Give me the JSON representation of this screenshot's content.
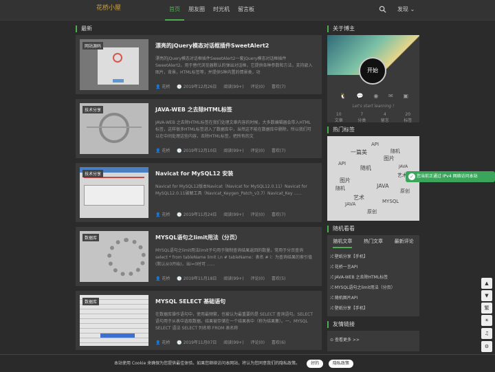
{
  "header": {
    "logo": "花桥小屋",
    "nav": [
      "首页",
      "朋友圈",
      "时光机",
      "留言板"
    ],
    "discover": "发现 ⌄"
  },
  "main": {
    "section_title": "最新",
    "posts": [
      {
        "tag": "网站源码",
        "title": "漂亮的jQuery模态对话框插件SweetAlert2",
        "desc": "漂亮的jQuery模态对话框插件SweetAlert2一套jQuery模态对话框插件SweetAlert2。用于替代浏览器默认的弹出对话框，它提供各种参数和方法，支持嵌入图片，背景，HTML标签等，并提供5种内置的情景类，功",
        "author": "花桥",
        "date": "2019年12月26日",
        "reads": "阅读(99+)",
        "comments": "评论(0)",
        "likes": "喜欢(7)"
      },
      {
        "tag": "技术分享",
        "title": "JAVA-WEB 之去除HTML标签",
        "desc": "JAVA-WEB 之去除HTML标签在我们处理文章内容的时候，大多数编辑器会带入HTML标签，这样很多HTML标签进入了数据库中，当然这不能在数据库中删除，所以我们可以在中间处理这些内容，去除HTML标签，把所有的文",
        "author": "花桥",
        "date": "2019年12月10日",
        "reads": "阅读(99+)",
        "comments": "评论(0)",
        "likes": "喜欢(7)"
      },
      {
        "tag": "技术分享",
        "title": "Navicat for MySQL12 安装",
        "desc": "Navicat for MySQL12版本Navicat（Navicat for MySQL12.0.11）Navicat for MySQL12.0.11破解工具（Navicat_Keygen_Patch_v3.7）Navicat_Key ......",
        "author": "花桥",
        "date": "2019年11月24日",
        "reads": "阅读(99+)",
        "comments": "评论(0)",
        "likes": "喜欢(7)"
      },
      {
        "tag": "数据库",
        "title": "MYSQL语句之limit用法（分页）",
        "desc": "MYSQL语句之limit用法limit子句用于限制查询结果返回的数量，常用于分页查询select * from tableName limit i,n # tableName：表名 # i：为查询结果的索引值(默认从0开始)，当i=0时可 ......",
        "author": "花桥",
        "date": "2019年11月18日",
        "reads": "阅读(99+)",
        "comments": "评论(0)",
        "likes": "喜欢(5)"
      },
      {
        "tag": "数据库",
        "title": "MYSQL SELECT 基础语句",
        "desc": "在数据库操作语句中，使用最频繁，也被认为最重要的是 SELECT 查询语句。SELECT 语句用于从表中选取数据。结果被存储在一个结果表中（称为结果集）。一、MYSQL SELECT 语法 SELECT 列名称 FROM 表名称",
        "author": "花桥",
        "date": "2019年11月07日",
        "reads": "阅读(99+)",
        "comments": "评论(0)",
        "likes": "喜欢(6)"
      }
    ]
  },
  "sidebar": {
    "about_title": "关于博主",
    "avatar_text": "开始",
    "motto": "Let's start learning !",
    "stats": [
      {
        "n": "10",
        "l": "文章"
      },
      {
        "n": "7",
        "l": "分类"
      },
      {
        "n": "4",
        "l": "留言"
      },
      {
        "n": "20",
        "l": "标签"
      }
    ],
    "tags_title": "热门标签",
    "tags": [
      "API",
      "一篇美",
      "随机",
      "图片",
      "API",
      "随机",
      "JAVA",
      "艺术",
      "图片",
      "JAVA",
      "随机",
      "艺术",
      "原创",
      "MYSQL",
      "JAVA",
      "原创"
    ],
    "random_title": "随机看看",
    "tabs": [
      "随机文章",
      "热门文章",
      "最新评论"
    ],
    "random": [
      "壁纸分享【手机】",
      "花桥一言API",
      "JAVA-WEB 之去除HTML标签",
      "MYSQL语句之limit用法（分页）",
      "随机图片API",
      "壁纸分享【手机】"
    ],
    "links_title": "友情链接",
    "links_more": "查看更多 >>"
  },
  "toast": "您当前正通过 IPv4 网络访问本站",
  "float_buttons": [
    "▲",
    "▼",
    "繁",
    "☀",
    "♫",
    "⚙"
  ],
  "cookie": {
    "text": "本站使用 Cookie 来确保为您提供最佳体验。如果您继续访问本网站，将认为您同意我们的隐私政策。",
    "ok": "好的",
    "policy": "隐私政策"
  }
}
